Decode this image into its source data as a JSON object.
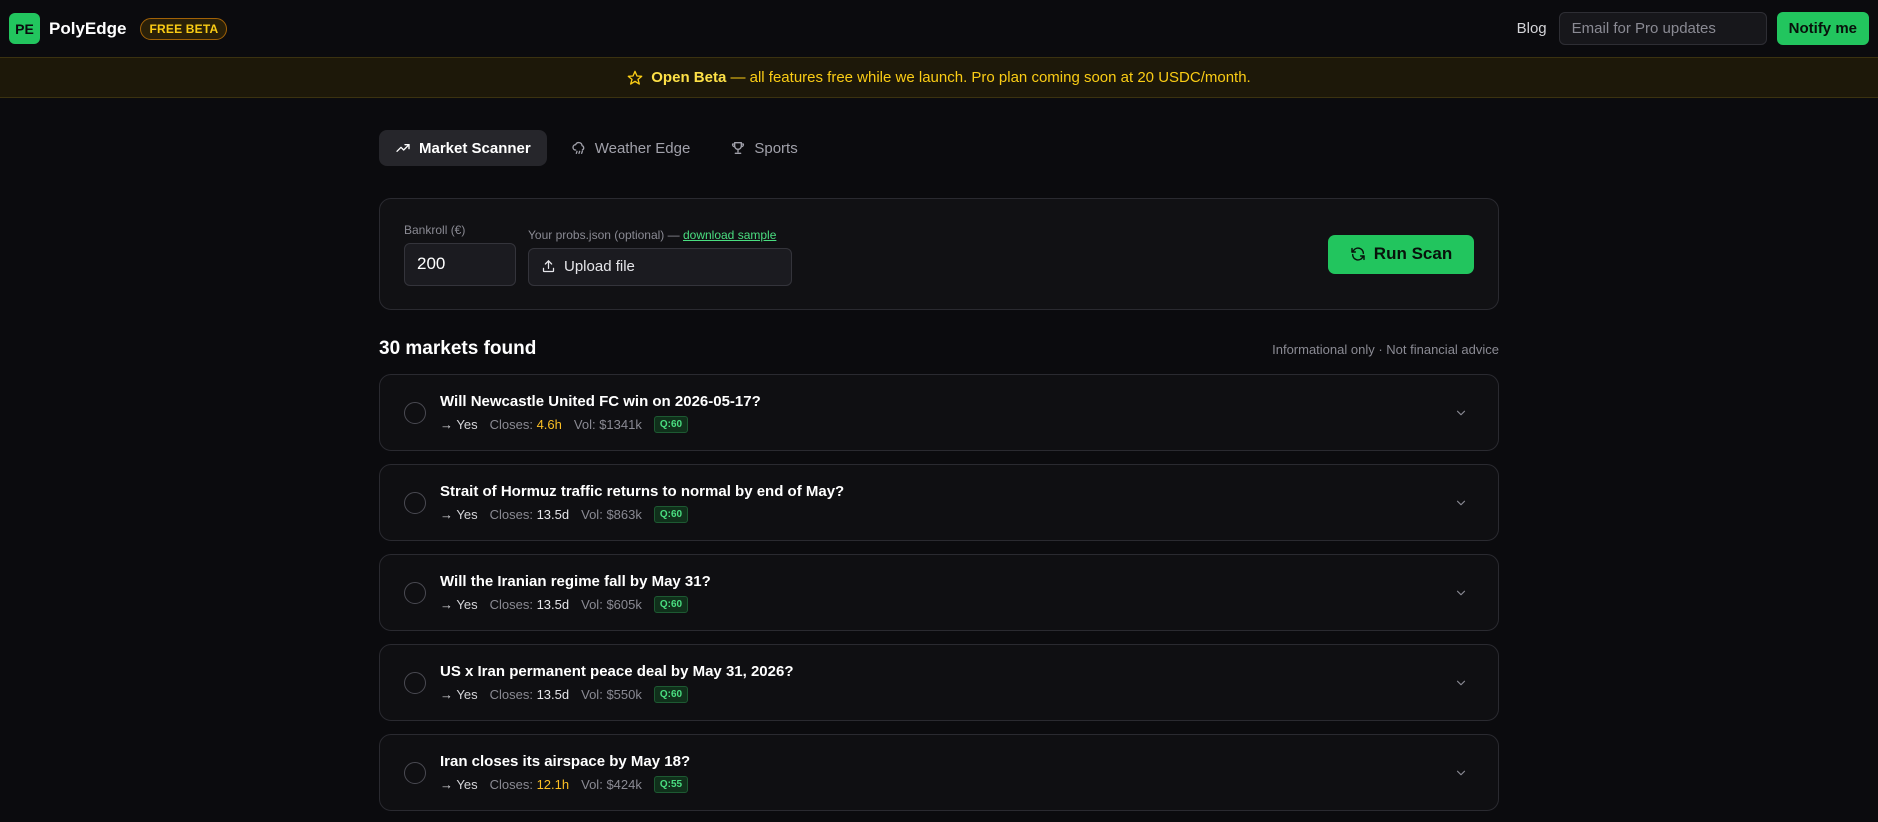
{
  "nav": {
    "logo_text": "PE",
    "brand": "PolyEdge",
    "badge": "FREE BETA",
    "blog": "Blog",
    "email_placeholder": "Email for Pro updates",
    "notify": "Notify me"
  },
  "banner": {
    "strong": "Open Beta",
    "text": "— all features free while we launch. Pro plan coming soon at 20 USDC/month."
  },
  "tabs": [
    {
      "label": "Market Scanner",
      "icon": "trending-up-icon",
      "active": true
    },
    {
      "label": "Weather Edge",
      "icon": "cloud-rain-icon",
      "active": false
    },
    {
      "label": "Sports",
      "icon": "trophy-icon",
      "active": false
    }
  ],
  "scan": {
    "bankroll_label": "Bankroll (€)",
    "bankroll_value": "200",
    "probs_label": "Your probs.json (optional) —",
    "sample_link": "download sample",
    "upload_label": "Upload file",
    "run_label": "Run Scan"
  },
  "results": {
    "title": "30 markets found",
    "disclaimer": "Informational only · Not financial advice",
    "closes_label": "Closes:",
    "vol_label": "Vol:",
    "markets": [
      {
        "question": "Will Newcastle United FC win on 2026-05-17?",
        "outcome": "→ Yes",
        "closes": "4.6h",
        "warn": true,
        "vol": "$1341k",
        "q": "Q:60"
      },
      {
        "question": "Strait of Hormuz traffic returns to normal by end of May?",
        "outcome": "→ Yes",
        "closes": "13.5d",
        "warn": false,
        "vol": "$863k",
        "q": "Q:60"
      },
      {
        "question": "Will the Iranian regime fall by May 31?",
        "outcome": "→ Yes",
        "closes": "13.5d",
        "warn": false,
        "vol": "$605k",
        "q": "Q:60"
      },
      {
        "question": "US x Iran permanent peace deal by May 31, 2026?",
        "outcome": "→ Yes",
        "closes": "13.5d",
        "warn": false,
        "vol": "$550k",
        "q": "Q:60"
      },
      {
        "question": "Iran closes its airspace by May 18?",
        "outcome": "→ Yes",
        "closes": "12.1h",
        "warn": true,
        "vol": "$424k",
        "q": "Q:55"
      }
    ]
  },
  "colors": {
    "accent": "#22c55e",
    "warning": "#fbbf24",
    "background": "#0b0b0e"
  }
}
